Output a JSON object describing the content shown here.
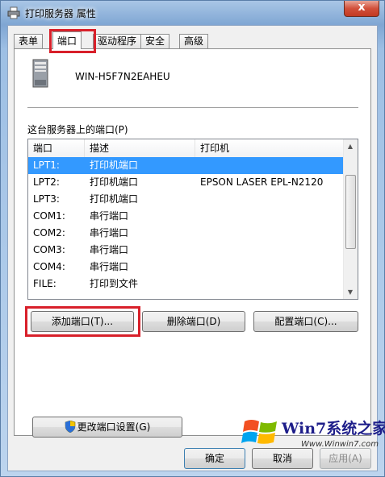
{
  "window": {
    "title": "打印服务器 属性",
    "close_label": "x"
  },
  "tabs": [
    {
      "label": "表单"
    },
    {
      "label": "端口",
      "active": true
    },
    {
      "label": "驱动程序"
    },
    {
      "label": "安全"
    },
    {
      "label": "高级"
    }
  ],
  "server": {
    "name": "WIN-H5F7N2EAHEU"
  },
  "ports_label": "这台服务器上的端口(P)",
  "list": {
    "columns": [
      "端口",
      "描述",
      "打印机"
    ],
    "rows": [
      {
        "port": "LPT1:",
        "desc": "打印机端口",
        "printer": "",
        "selected": true
      },
      {
        "port": "LPT2:",
        "desc": "打印机端口",
        "printer": "EPSON LASER EPL-N2120"
      },
      {
        "port": "LPT3:",
        "desc": "打印机端口",
        "printer": ""
      },
      {
        "port": "COM1:",
        "desc": "串行端口",
        "printer": ""
      },
      {
        "port": "COM2:",
        "desc": "串行端口",
        "printer": ""
      },
      {
        "port": "COM3:",
        "desc": "串行端口",
        "printer": ""
      },
      {
        "port": "COM4:",
        "desc": "串行端口",
        "printer": ""
      },
      {
        "port": "FILE:",
        "desc": "打印到文件",
        "printer": ""
      }
    ]
  },
  "buttons": {
    "add_port": "添加端口(T)...",
    "delete_port": "删除端口(D)",
    "configure_port": "配置端口(C)...",
    "change_settings": "更改端口设置(G)",
    "ok": "确定",
    "cancel": "取消",
    "apply": "应用(A)"
  },
  "watermark": {
    "brand": "Win7系统之家",
    "url": "Www.Winwin7.com"
  },
  "colors": {
    "selection": "#3399ff",
    "highlight_box": "#d8202a"
  }
}
